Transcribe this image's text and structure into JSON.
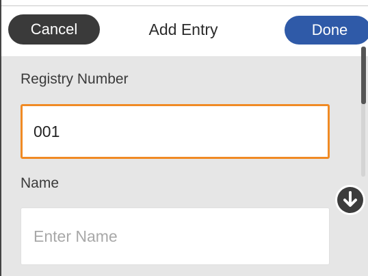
{
  "header": {
    "cancel_label": "Cancel",
    "title": "Add Entry",
    "done_label": "Done"
  },
  "form": {
    "registry_number": {
      "label": "Registry Number",
      "value": "001"
    },
    "name": {
      "label": "Name",
      "value": "",
      "placeholder": "Enter Name"
    }
  },
  "icons": {
    "scroll_down": "arrow-down-circle-icon"
  },
  "colors": {
    "cancel_button": "#3a3a3a",
    "done_button": "#2f5aa8",
    "focused_field_border": "#f08a24",
    "content_background": "#e6e6e6"
  }
}
